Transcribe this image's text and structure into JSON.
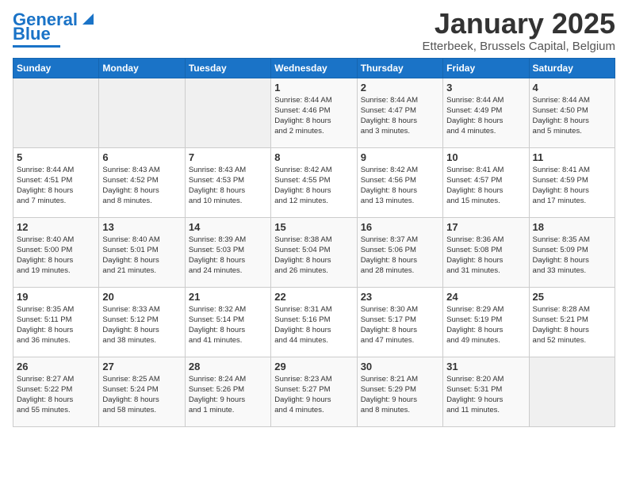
{
  "header": {
    "logo_line1": "General",
    "logo_line2": "Blue",
    "title": "January 2025",
    "subtitle": "Etterbeek, Brussels Capital, Belgium"
  },
  "weekdays": [
    "Sunday",
    "Monday",
    "Tuesday",
    "Wednesday",
    "Thursday",
    "Friday",
    "Saturday"
  ],
  "weeks": [
    [
      {
        "day": "",
        "info": ""
      },
      {
        "day": "",
        "info": ""
      },
      {
        "day": "",
        "info": ""
      },
      {
        "day": "1",
        "info": "Sunrise: 8:44 AM\nSunset: 4:46 PM\nDaylight: 8 hours\nand 2 minutes."
      },
      {
        "day": "2",
        "info": "Sunrise: 8:44 AM\nSunset: 4:47 PM\nDaylight: 8 hours\nand 3 minutes."
      },
      {
        "day": "3",
        "info": "Sunrise: 8:44 AM\nSunset: 4:49 PM\nDaylight: 8 hours\nand 4 minutes."
      },
      {
        "day": "4",
        "info": "Sunrise: 8:44 AM\nSunset: 4:50 PM\nDaylight: 8 hours\nand 5 minutes."
      }
    ],
    [
      {
        "day": "5",
        "info": "Sunrise: 8:44 AM\nSunset: 4:51 PM\nDaylight: 8 hours\nand 7 minutes."
      },
      {
        "day": "6",
        "info": "Sunrise: 8:43 AM\nSunset: 4:52 PM\nDaylight: 8 hours\nand 8 minutes."
      },
      {
        "day": "7",
        "info": "Sunrise: 8:43 AM\nSunset: 4:53 PM\nDaylight: 8 hours\nand 10 minutes."
      },
      {
        "day": "8",
        "info": "Sunrise: 8:42 AM\nSunset: 4:55 PM\nDaylight: 8 hours\nand 12 minutes."
      },
      {
        "day": "9",
        "info": "Sunrise: 8:42 AM\nSunset: 4:56 PM\nDaylight: 8 hours\nand 13 minutes."
      },
      {
        "day": "10",
        "info": "Sunrise: 8:41 AM\nSunset: 4:57 PM\nDaylight: 8 hours\nand 15 minutes."
      },
      {
        "day": "11",
        "info": "Sunrise: 8:41 AM\nSunset: 4:59 PM\nDaylight: 8 hours\nand 17 minutes."
      }
    ],
    [
      {
        "day": "12",
        "info": "Sunrise: 8:40 AM\nSunset: 5:00 PM\nDaylight: 8 hours\nand 19 minutes."
      },
      {
        "day": "13",
        "info": "Sunrise: 8:40 AM\nSunset: 5:01 PM\nDaylight: 8 hours\nand 21 minutes."
      },
      {
        "day": "14",
        "info": "Sunrise: 8:39 AM\nSunset: 5:03 PM\nDaylight: 8 hours\nand 24 minutes."
      },
      {
        "day": "15",
        "info": "Sunrise: 8:38 AM\nSunset: 5:04 PM\nDaylight: 8 hours\nand 26 minutes."
      },
      {
        "day": "16",
        "info": "Sunrise: 8:37 AM\nSunset: 5:06 PM\nDaylight: 8 hours\nand 28 minutes."
      },
      {
        "day": "17",
        "info": "Sunrise: 8:36 AM\nSunset: 5:08 PM\nDaylight: 8 hours\nand 31 minutes."
      },
      {
        "day": "18",
        "info": "Sunrise: 8:35 AM\nSunset: 5:09 PM\nDaylight: 8 hours\nand 33 minutes."
      }
    ],
    [
      {
        "day": "19",
        "info": "Sunrise: 8:35 AM\nSunset: 5:11 PM\nDaylight: 8 hours\nand 36 minutes."
      },
      {
        "day": "20",
        "info": "Sunrise: 8:33 AM\nSunset: 5:12 PM\nDaylight: 8 hours\nand 38 minutes."
      },
      {
        "day": "21",
        "info": "Sunrise: 8:32 AM\nSunset: 5:14 PM\nDaylight: 8 hours\nand 41 minutes."
      },
      {
        "day": "22",
        "info": "Sunrise: 8:31 AM\nSunset: 5:16 PM\nDaylight: 8 hours\nand 44 minutes."
      },
      {
        "day": "23",
        "info": "Sunrise: 8:30 AM\nSunset: 5:17 PM\nDaylight: 8 hours\nand 47 minutes."
      },
      {
        "day": "24",
        "info": "Sunrise: 8:29 AM\nSunset: 5:19 PM\nDaylight: 8 hours\nand 49 minutes."
      },
      {
        "day": "25",
        "info": "Sunrise: 8:28 AM\nSunset: 5:21 PM\nDaylight: 8 hours\nand 52 minutes."
      }
    ],
    [
      {
        "day": "26",
        "info": "Sunrise: 8:27 AM\nSunset: 5:22 PM\nDaylight: 8 hours\nand 55 minutes."
      },
      {
        "day": "27",
        "info": "Sunrise: 8:25 AM\nSunset: 5:24 PM\nDaylight: 8 hours\nand 58 minutes."
      },
      {
        "day": "28",
        "info": "Sunrise: 8:24 AM\nSunset: 5:26 PM\nDaylight: 9 hours\nand 1 minute."
      },
      {
        "day": "29",
        "info": "Sunrise: 8:23 AM\nSunset: 5:27 PM\nDaylight: 9 hours\nand 4 minutes."
      },
      {
        "day": "30",
        "info": "Sunrise: 8:21 AM\nSunset: 5:29 PM\nDaylight: 9 hours\nand 8 minutes."
      },
      {
        "day": "31",
        "info": "Sunrise: 8:20 AM\nSunset: 5:31 PM\nDaylight: 9 hours\nand 11 minutes."
      },
      {
        "day": "",
        "info": ""
      }
    ]
  ]
}
